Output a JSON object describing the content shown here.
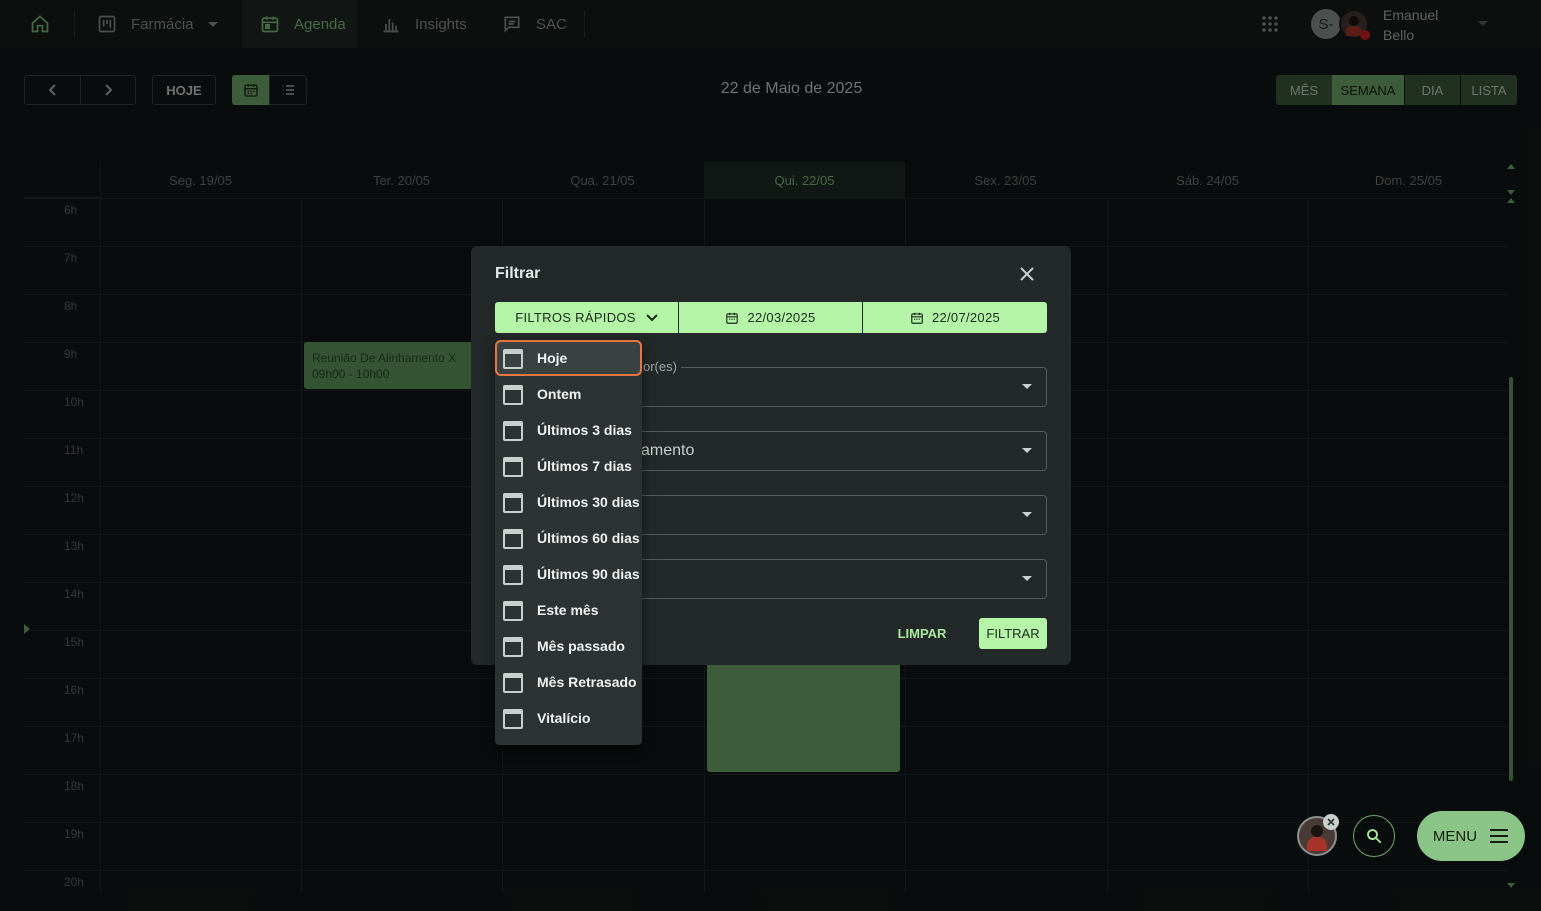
{
  "nav": {
    "home_icon": "home-icon",
    "farmacia": "Farmácia",
    "agenda": "Agenda",
    "insights": "Insights",
    "sac": "SAC",
    "user_initial": "S-",
    "user_first": "Emanuel",
    "user_last": "Bello"
  },
  "toolbar": {
    "today": "HOJE",
    "date_title": "22 de Maio de 2025",
    "views": [
      "MÊS",
      "SEMANA",
      "DIA",
      "LISTA"
    ],
    "active_view": "SEMANA"
  },
  "calendar": {
    "days": [
      "Seg. 19/05",
      "Ter. 20/05",
      "Qua. 21/05",
      "Qui. 22/05",
      "Sex. 23/05",
      "Sáb. 24/05",
      "Dom. 25/05"
    ],
    "today_index": 3,
    "hours": [
      "6h",
      "7h",
      "8h",
      "9h",
      "10h",
      "11h",
      "12h",
      "13h",
      "14h",
      "15h",
      "16h",
      "17h",
      "18h",
      "19h",
      "20h"
    ],
    "event": {
      "title": "Reunião De Alinhamento X",
      "time": "09h00 - 10h00"
    }
  },
  "dialog": {
    "title": "Filtrar",
    "quick_filters": "FILTROS RÁPIDOS",
    "date_from": "22/03/2025",
    "date_to": "22/07/2025",
    "field1_label_partial": "or(es)",
    "field2_value_partial": "amento",
    "clear": "LIMPAR",
    "filter": "FILTRAR"
  },
  "quick_menu": {
    "items": [
      "Hoje",
      "Ontem",
      "Últimos 3 dias",
      "Últimos 7 dias",
      "Últimos 30 dias",
      "Últimos 60 dias",
      "Últimos 90 dias",
      "Este mês",
      "Mês passado",
      "Mês Retrasado",
      "Vitalício"
    ],
    "selected": "Hoje"
  },
  "fab": {
    "menu": "MENU"
  },
  "colors": {
    "accent": "#b4f5a8",
    "green": "#7cc27a",
    "highlight": "#e8763f"
  }
}
